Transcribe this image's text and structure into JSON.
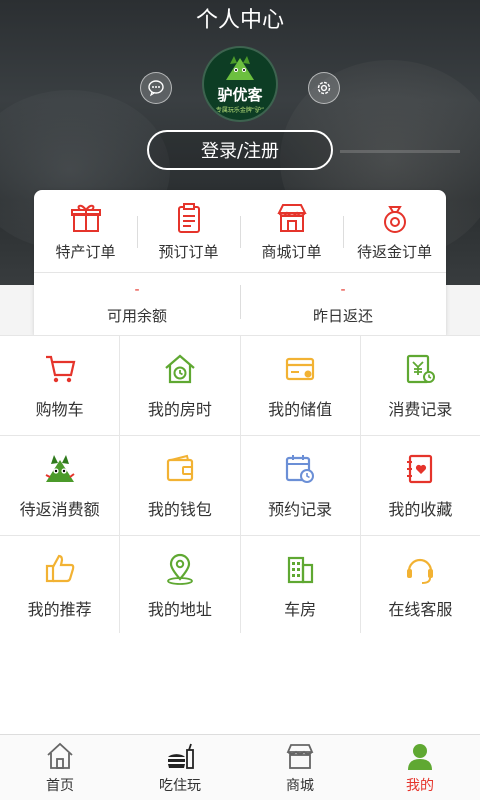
{
  "header": {
    "title": "个人中心",
    "login_label": "登录/注册",
    "logo": {
      "brand": "驴优客",
      "slogan": "专属玩乐金牌“驴”"
    },
    "left_icon": "chat-icon",
    "right_icon": "settings-icon"
  },
  "orders": [
    {
      "label": "特产订单",
      "icon": "gift-icon"
    },
    {
      "label": "预订订单",
      "icon": "clipboard-icon"
    },
    {
      "label": "商城订单",
      "icon": "store-icon"
    },
    {
      "label": "待返金订单",
      "icon": "money-bag-icon"
    }
  ],
  "stats": [
    {
      "value": "-",
      "label": "可用余额"
    },
    {
      "value": "-",
      "label": "昨日返还"
    }
  ],
  "grid": [
    {
      "label": "购物车",
      "icon": "cart-icon"
    },
    {
      "label": "我的房时",
      "icon": "house-clock-icon"
    },
    {
      "label": "我的储值",
      "icon": "card-icon"
    },
    {
      "label": "消费记录",
      "icon": "receipt-icon"
    },
    {
      "label": "待返消费额",
      "icon": "mascot-icon"
    },
    {
      "label": "我的钱包",
      "icon": "wallet-icon"
    },
    {
      "label": "预约记录",
      "icon": "calendar-clock-icon"
    },
    {
      "label": "我的收藏",
      "icon": "favorite-book-icon"
    },
    {
      "label": "我的推荐",
      "icon": "thumbs-up-icon"
    },
    {
      "label": "我的地址",
      "icon": "location-icon"
    },
    {
      "label": "车房",
      "icon": "building-icon"
    },
    {
      "label": "在线客服",
      "icon": "headset-icon"
    }
  ],
  "tabs": [
    {
      "label": "首页",
      "icon": "home-icon"
    },
    {
      "label": "吃住玩",
      "icon": "food-icon"
    },
    {
      "label": "商城",
      "icon": "shop-icon"
    },
    {
      "label": "我的",
      "icon": "user-icon",
      "active": true
    }
  ],
  "colors": {
    "accent_red": "#e5342b",
    "brand_green": "#0d3d24",
    "icon_green": "#5fa832",
    "icon_yellow": "#f2b233",
    "icon_blue": "#6b8fd6"
  }
}
